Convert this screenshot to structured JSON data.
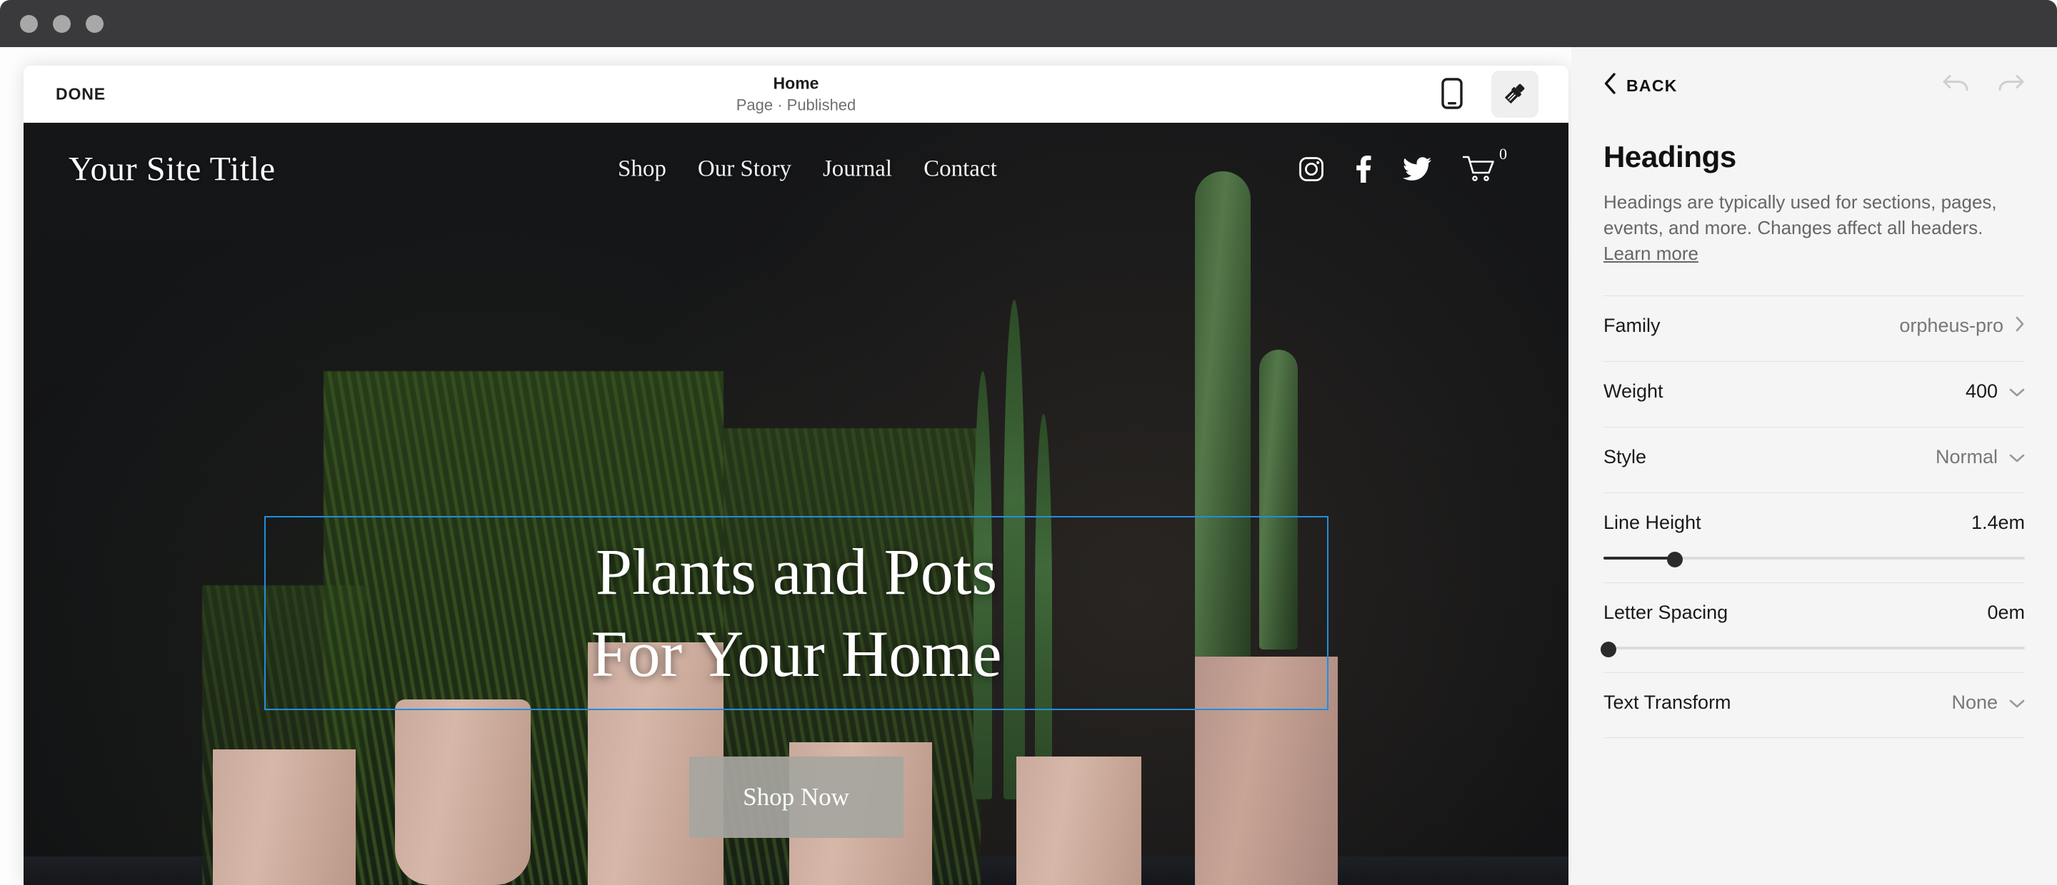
{
  "window": {
    "traffic_lights": [
      "close",
      "minimize",
      "maximize"
    ]
  },
  "editor_toolbar": {
    "done_label": "DONE",
    "page_title": "Home",
    "page_status": "Page · Published",
    "mobile_view_icon": "mobile-device-icon",
    "style_editor_icon": "paintbrush-icon"
  },
  "site_preview": {
    "site_title": "Your Site Title",
    "nav_links": [
      {
        "label": "Shop"
      },
      {
        "label": "Our Story"
      },
      {
        "label": "Journal"
      },
      {
        "label": "Contact"
      }
    ],
    "social_icons": [
      {
        "name": "instagram-icon"
      },
      {
        "name": "facebook-icon"
      },
      {
        "name": "twitter-icon"
      }
    ],
    "cart": {
      "icon": "shopping-cart-icon",
      "count": "0"
    },
    "headline_line1": "Plants and Pots",
    "headline_line2": "For Your Home",
    "cta_label": "Shop Now",
    "selection_color": "#1f8fe0"
  },
  "panel": {
    "back_label": "BACK",
    "undo_icon": "undo-arrow-icon",
    "redo_icon": "redo-arrow-icon",
    "title": "Headings",
    "description_text": "Headings are typically used for sections, pages, events, and more. Changes affect all headers. ",
    "description_link": "Learn more",
    "settings": [
      {
        "label": "Family",
        "value": "orpheus-pro",
        "control": "chevron-right"
      },
      {
        "label": "Weight",
        "value": "400",
        "control": "chevron-down"
      },
      {
        "label": "Style",
        "value": "Normal",
        "control": "chevron-down"
      },
      {
        "label": "Line Height",
        "value": "1.4em",
        "control": "slider",
        "slider_percent": 17
      },
      {
        "label": "Letter Spacing",
        "value": "0em",
        "control": "slider",
        "slider_percent": 0
      },
      {
        "label": "Text Transform",
        "value": "None",
        "control": "chevron-down"
      }
    ]
  },
  "colors": {
    "titlebar": "#3a3a3c",
    "panel_bg": "#f5f5f5",
    "accent_selection": "#1f8fe0",
    "cta_button": "#a6a5a0"
  }
}
